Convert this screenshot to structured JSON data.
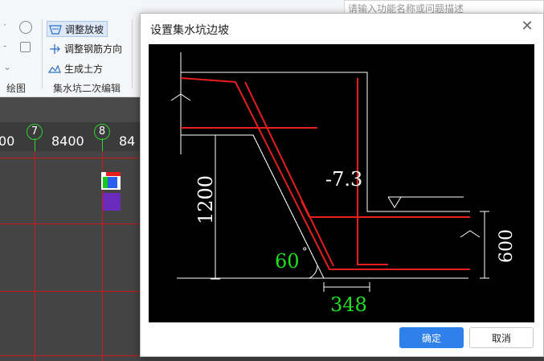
{
  "ribbon": {
    "search_placeholder": "请输入功能名称或问题描述",
    "buttons": [
      {
        "label": "调整放坡",
        "icon": "slope-adjust-icon",
        "active": true
      },
      {
        "label": "调整钢筋方向",
        "icon": "rebar-direction-icon",
        "active": false
      },
      {
        "label": "生成土方",
        "icon": "earthwork-icon",
        "active": false
      }
    ],
    "groups": {
      "draw": "绘图",
      "sump_edit": "集水坑二次编辑"
    }
  },
  "canvas": {
    "axes": [
      {
        "id": "7"
      },
      {
        "id": "8"
      }
    ],
    "dims": [
      "00",
      "8400",
      "84"
    ]
  },
  "dialog": {
    "title": "设置集水坑边坡",
    "ok_label": "确定",
    "cancel_label": "取消",
    "drawing": {
      "elevation": "-7.3",
      "height_label": "1200",
      "right_height_label": "600",
      "angle_label": "60",
      "degree_symbol": "°",
      "bottom_label": "348"
    }
  },
  "colors": {
    "accent": "#2f80e8",
    "rebar_red": "#e61e1e",
    "param_green": "#1ee01e"
  }
}
